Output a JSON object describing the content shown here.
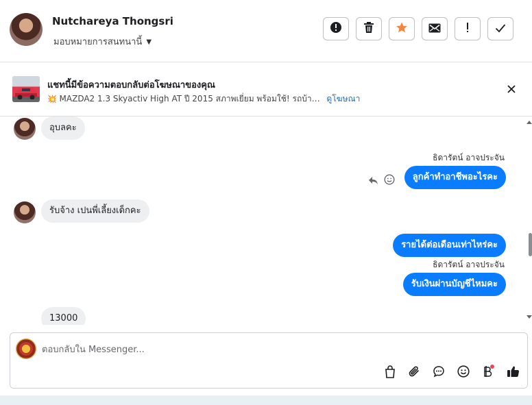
{
  "header": {
    "contact_name": "Nutchareya Thongsri",
    "assign_label": "มอบหมายการสนทนานี้",
    "actions": [
      {
        "name": "report",
        "icon": "alert-circle-icon"
      },
      {
        "name": "delete",
        "icon": "trash-icon"
      },
      {
        "name": "star",
        "icon": "star-icon",
        "color": "#f5853f"
      },
      {
        "name": "email",
        "icon": "envelope-icon"
      },
      {
        "name": "important",
        "icon": "exclamation-icon"
      },
      {
        "name": "done",
        "icon": "checkmark-icon"
      }
    ]
  },
  "ad": {
    "title": "แชทนี้มีข้อความตอบกลับต่อโฆษณาของคุณ",
    "description": "MAZDA2 1.3 Skyactiv High AT ปี 2015 สภาพเยี่ยม พร้อมใช้! รถบ้า…",
    "link": "ดูโฆษณา"
  },
  "messages": [
    {
      "direction": "in",
      "text": "อุบลคะ"
    },
    {
      "direction": "out",
      "sender": "ธิดารัตน์ อาจประจัน",
      "text": "ลูกค้าทำอาชีพอะไรคะ"
    },
    {
      "direction": "in",
      "text": "รับจ้าง  เปนพี่เลี้ยงเด็กคะ"
    },
    {
      "direction": "out",
      "text": "รายได้ต่อเดือนเท่าไหร่คะ"
    },
    {
      "direction": "out",
      "sender": "ธิดารัตน์ อาจประจัน",
      "text": "รับเงินผ่านบัญชีไหมคะ"
    },
    {
      "direction": "in",
      "text": "13000"
    }
  ],
  "composer": {
    "placeholder": "ตอบกลับใน Messenger...",
    "tools": [
      "shopping-bag-icon",
      "paperclip-icon",
      "chat-bubble-icon",
      "smiley-icon",
      "baht-icon",
      "thumbs-up-icon"
    ]
  },
  "colors": {
    "accent": "#0a7cff",
    "incoming_bubble": "#eeeff1",
    "star": "#f5853f",
    "link": "#1c6fb8"
  }
}
